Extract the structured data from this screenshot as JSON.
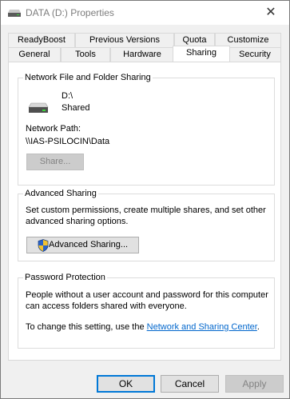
{
  "window": {
    "title": "DATA (D:) Properties",
    "close_glyph": "✕"
  },
  "tabs_row1": [
    {
      "label": "ReadyBoost"
    },
    {
      "label": "Previous Versions"
    },
    {
      "label": "Quota"
    },
    {
      "label": "Customize"
    }
  ],
  "tabs_row2": [
    {
      "label": "General"
    },
    {
      "label": "Tools"
    },
    {
      "label": "Hardware"
    },
    {
      "label": "Sharing",
      "active": true
    },
    {
      "label": "Security"
    }
  ],
  "network_sharing": {
    "title": "Network File and Folder Sharing",
    "drive_name": "D:\\",
    "drive_status": "Shared",
    "path_label": "Network Path:",
    "path_value": "\\\\IAS-PSILOCIN\\Data",
    "share_button": "Share..."
  },
  "advanced_sharing": {
    "title": "Advanced Sharing",
    "description_line1": "Set custom permissions, create multiple shares, and set other",
    "description_line2": "advanced sharing options.",
    "button": "Advanced Sharing..."
  },
  "password_protection": {
    "title": "Password Protection",
    "line1": "People without a user account and password for this computer",
    "line2": "can access folders shared with everyone.",
    "change_text": "To change this setting, use the ",
    "link_text": "Network and Sharing Center",
    "suffix": "."
  },
  "footer": {
    "ok": "OK",
    "cancel": "Cancel",
    "apply": "Apply"
  },
  "icons": {
    "drive": "drive-icon",
    "shield": "uac-shield-icon"
  },
  "colors": {
    "link": "#0066cc",
    "accent": "#0078d7"
  }
}
